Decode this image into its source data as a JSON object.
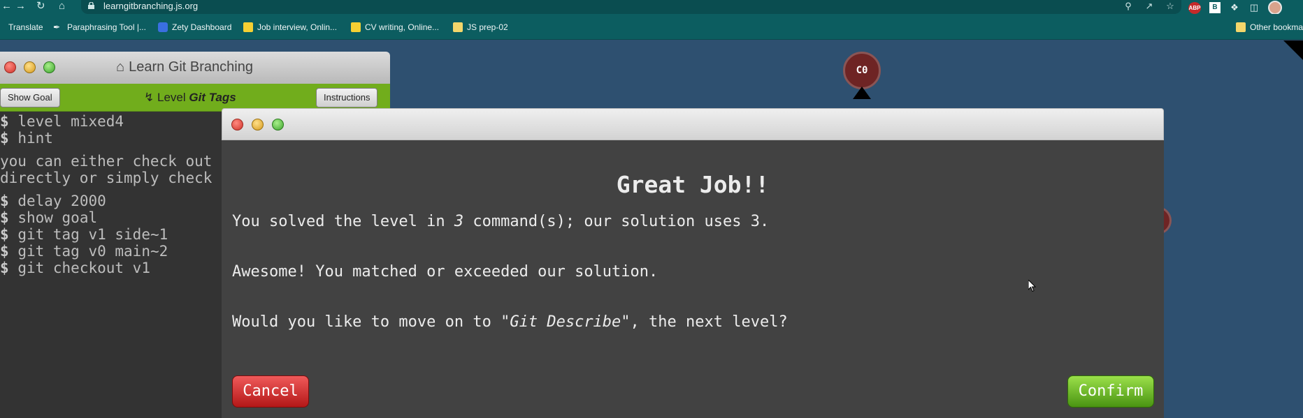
{
  "browser": {
    "url": "learngitbranching.js.org",
    "bookmarks": [
      {
        "label": "Translate"
      },
      {
        "label": "Paraphrasing Tool |..."
      },
      {
        "label": "Zety Dashboard"
      },
      {
        "label": "Job interview, Onlin..."
      },
      {
        "label": "CV writing, Online..."
      },
      {
        "label": "JS prep-02"
      }
    ],
    "other_bookmarks": "Other bookma",
    "extensions": {
      "abp": "ABP",
      "b": "B"
    }
  },
  "visualization": {
    "commit_label": "C0",
    "colors": {
      "background": "#2e5070",
      "commit": "#6e2424"
    }
  },
  "terminal": {
    "title": "Learn Git Branching",
    "show_goal": "Show Goal",
    "level_prefix": "Level",
    "level_name": "Git Tags",
    "instructions": "Instructions",
    "lines": [
      {
        "prompt": "$",
        "text": "level mixed4"
      },
      {
        "prompt": "$",
        "text": "hint"
      },
      {
        "prompt": "",
        "text": "you can either check out"
      },
      {
        "prompt": "",
        "text": "directly or simply check"
      },
      {
        "prompt": "$",
        "text": "delay 2000"
      },
      {
        "prompt": "$",
        "text": "show goal"
      },
      {
        "prompt": "$",
        "text": "git tag v1 side~1"
      },
      {
        "prompt": "$",
        "text": "git tag v0 main~2"
      },
      {
        "prompt": "$",
        "text": "git checkout v1"
      }
    ]
  },
  "dialog": {
    "heading": "Great Job!!",
    "solved_prefix": "You solved the level in ",
    "solved_count": "3",
    "solved_suffix": " command(s); our solution uses 3.",
    "matched": "Awesome! You matched or exceeded our solution.",
    "next_prefix": "Would you like to move on to ",
    "next_level": "\"Git Describe\"",
    "next_suffix": ", the next level?",
    "cancel_label": "Cancel",
    "confirm_label": "Confirm"
  }
}
